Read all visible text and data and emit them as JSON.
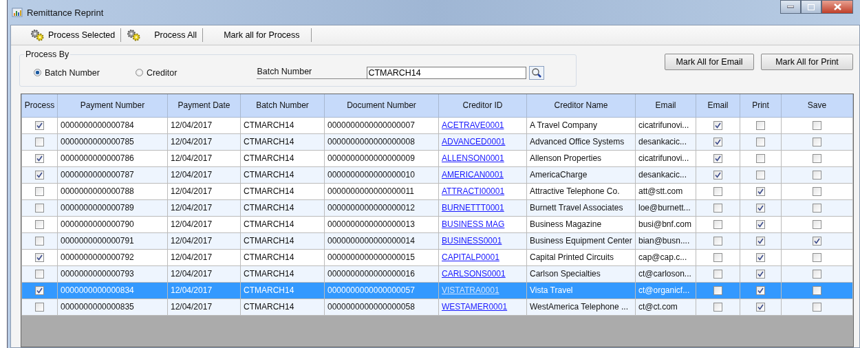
{
  "window": {
    "title": "Remittance Reprint"
  },
  "toolbar": [
    {
      "label": "Process Selected",
      "kind": "gears"
    },
    {
      "label": "Process All",
      "kind": "gears"
    },
    {
      "label": "Mark all for Process",
      "kind": "plain"
    }
  ],
  "process_by": {
    "title": "Process By",
    "options": [
      {
        "label": "Batch Number",
        "selected": true
      },
      {
        "label": "Creditor",
        "selected": false
      }
    ],
    "field_label": "Batch Number",
    "value": "CTMARCH14"
  },
  "buttons": [
    "Mark All for Email",
    "Mark All for Print"
  ],
  "table": {
    "columns": [
      "Process",
      "Payment Number",
      "Payment Date",
      "Batch Number",
      "Document Number",
      "Creditor ID",
      "Creditor Name",
      "Email",
      "Email",
      "Print",
      "Save"
    ],
    "rows": [
      {
        "process": true,
        "payment_number": "0000000000000784",
        "payment_date": "12/04/2017",
        "batch_number": "CTMARCH14",
        "document_number": "0000000000000000007",
        "creditor_id": "ACETRAVE0001",
        "creditor_name": "A Travel Company",
        "email": "cicatrifunovi...",
        "email_checked": true,
        "print": false,
        "save": false,
        "selected": false
      },
      {
        "process": false,
        "payment_number": "0000000000000785",
        "payment_date": "12/04/2017",
        "batch_number": "CTMARCH14",
        "document_number": "0000000000000000008",
        "creditor_id": "ADVANCED0001",
        "creditor_name": "Advanced Office Systems",
        "email": "desankacic...",
        "email_checked": true,
        "print": false,
        "save": false,
        "selected": false
      },
      {
        "process": true,
        "payment_number": "0000000000000786",
        "payment_date": "12/04/2017",
        "batch_number": "CTMARCH14",
        "document_number": "0000000000000000009",
        "creditor_id": "ALLENSON0001",
        "creditor_name": "Allenson Properties",
        "email": "cicatrifunovi...",
        "email_checked": true,
        "print": false,
        "save": false,
        "selected": false
      },
      {
        "process": true,
        "payment_number": "0000000000000787",
        "payment_date": "12/04/2017",
        "batch_number": "CTMARCH14",
        "document_number": "0000000000000000010",
        "creditor_id": "AMERICAN0001",
        "creditor_name": "AmericaCharge",
        "email": "desankacic...",
        "email_checked": true,
        "print": false,
        "save": false,
        "selected": false
      },
      {
        "process": false,
        "payment_number": "0000000000000788",
        "payment_date": "12/04/2017",
        "batch_number": "CTMARCH14",
        "document_number": "0000000000000000011",
        "creditor_id": "ATTRACTI00001",
        "creditor_name": "Attractive Telephone Co.",
        "email": "att@stt.com",
        "email_checked": false,
        "print": true,
        "save": false,
        "selected": false
      },
      {
        "process": false,
        "payment_number": "0000000000000789",
        "payment_date": "12/04/2017",
        "batch_number": "CTMARCH14",
        "document_number": "0000000000000000012",
        "creditor_id": "BURNETTT0001",
        "creditor_name": "Burnett Travel Associates",
        "email": "loe@burnett...",
        "email_checked": false,
        "print": true,
        "save": false,
        "selected": false
      },
      {
        "process": false,
        "payment_number": "0000000000000790",
        "payment_date": "12/04/2017",
        "batch_number": "CTMARCH14",
        "document_number": "0000000000000000013",
        "creditor_id": "BUSINESS MAG",
        "creditor_name": "Business Magazine",
        "email": "busi@bnf.com",
        "email_checked": false,
        "print": true,
        "save": false,
        "selected": false
      },
      {
        "process": false,
        "payment_number": "0000000000000791",
        "payment_date": "12/04/2017",
        "batch_number": "CTMARCH14",
        "document_number": "0000000000000000014",
        "creditor_id": "BUSINESS0001",
        "creditor_name": "Business Equipment Center",
        "email": "bian@busn....",
        "email_checked": false,
        "print": true,
        "save": true,
        "selected": false
      },
      {
        "process": true,
        "payment_number": "0000000000000792",
        "payment_date": "12/04/2017",
        "batch_number": "CTMARCH14",
        "document_number": "0000000000000000015",
        "creditor_id": "CAPITALP0001",
        "creditor_name": "Capital Printed Circuits",
        "email": "cap@cap.c...",
        "email_checked": false,
        "print": true,
        "save": false,
        "selected": false
      },
      {
        "process": false,
        "payment_number": "0000000000000793",
        "payment_date": "12/04/2017",
        "batch_number": "CTMARCH14",
        "document_number": "0000000000000000016",
        "creditor_id": "CARLSONS0001",
        "creditor_name": "Carlson Specialties",
        "email": "ct@carloson...",
        "email_checked": false,
        "print": true,
        "save": false,
        "selected": false
      },
      {
        "process": true,
        "payment_number": "0000000000000834",
        "payment_date": "12/04/2017",
        "batch_number": "CTMARCH14",
        "document_number": "0000000000000000057",
        "creditor_id": "VISTATRA0001",
        "creditor_name": "Vista Travel",
        "email": "ct@organicf...",
        "email_checked": false,
        "print": true,
        "save": false,
        "selected": true
      },
      {
        "process": false,
        "payment_number": "0000000000000835",
        "payment_date": "12/04/2017",
        "batch_number": "CTMARCH14",
        "document_number": "0000000000000000058",
        "creditor_id": "WESTAMER0001",
        "creditor_name": "WestAmerica Telephone ...",
        "email": "ct@ct.com",
        "email_checked": false,
        "print": true,
        "save": false,
        "selected": false
      }
    ]
  }
}
